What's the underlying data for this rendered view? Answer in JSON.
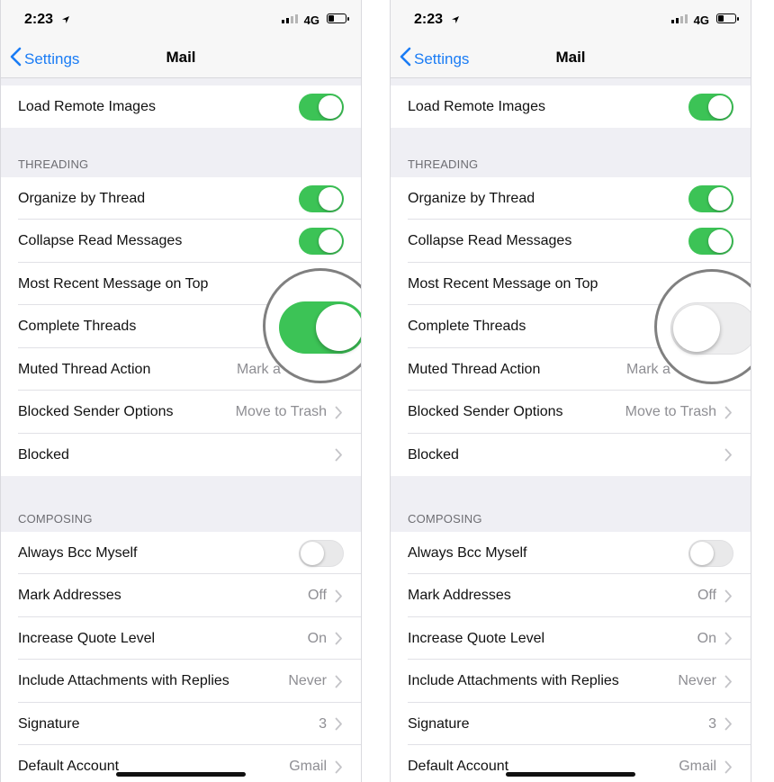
{
  "status_bar": {
    "time": "2:23",
    "network": "4G",
    "battery_level": 0.35
  },
  "nav": {
    "back_label": "Settings",
    "title": "Mail"
  },
  "rows": {
    "load_remote_images": {
      "label": "Load Remote Images",
      "toggle": "on"
    },
    "threading_header": "THREADING",
    "organize_by_thread": {
      "label": "Organize by Thread",
      "toggle": "on"
    },
    "collapse_read_messages": {
      "label": "Collapse Read Messages",
      "toggle": "on"
    },
    "most_recent_on_top": {
      "label": "Most Recent Message on Top"
    },
    "complete_threads": {
      "label": "Complete Threads"
    },
    "muted_thread_action": {
      "label": "Muted Thread Action",
      "value": "Mark a"
    },
    "blocked_sender_options": {
      "label": "Blocked Sender Options",
      "value": "Move to Trash"
    },
    "blocked": {
      "label": "Blocked"
    },
    "composing_header": "COMPOSING",
    "always_bcc_myself": {
      "label": "Always Bcc Myself",
      "toggle": "off"
    },
    "mark_addresses": {
      "label": "Mark Addresses",
      "value": "Off"
    },
    "increase_quote_level": {
      "label": "Increase Quote Level",
      "value": "On"
    },
    "include_attachments": {
      "label": "Include Attachments with Replies",
      "value": "Never"
    },
    "signature": {
      "label": "Signature",
      "value": "3"
    },
    "default_account": {
      "label": "Default Account",
      "value": "Gmail"
    }
  },
  "panels": [
    {
      "complete_threads_toggle": "on"
    },
    {
      "complete_threads_toggle": "off"
    }
  ],
  "colors": {
    "accent": "#1a7cf5",
    "toggle_on": "#3cc356",
    "toggle_off": "#e9e9ea",
    "zoom_ring": "#808080"
  }
}
